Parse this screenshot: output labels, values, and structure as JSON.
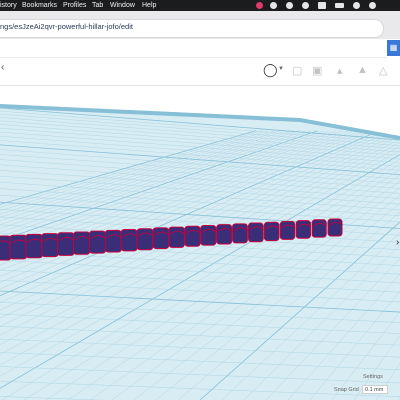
{
  "menubar": {
    "items": [
      "istory",
      "Bookmarks",
      "Profiles",
      "Tab",
      "Window",
      "Help"
    ]
  },
  "browser": {
    "url": "ngs/esJzeAi2qvr-powerful-hillar-jofo/edit"
  },
  "workplane": {
    "settings_label": "Settings",
    "snap_grid_label": "Snap Grid",
    "snap_grid_value": "0.1 mm"
  },
  "colors": {
    "grid_fill": "#d7ecf3",
    "grid_line": "#a9d2e2",
    "grid_major": "#87bfd6",
    "chain_fill": "#3a2e78",
    "chain_edge": "#c8003d"
  }
}
